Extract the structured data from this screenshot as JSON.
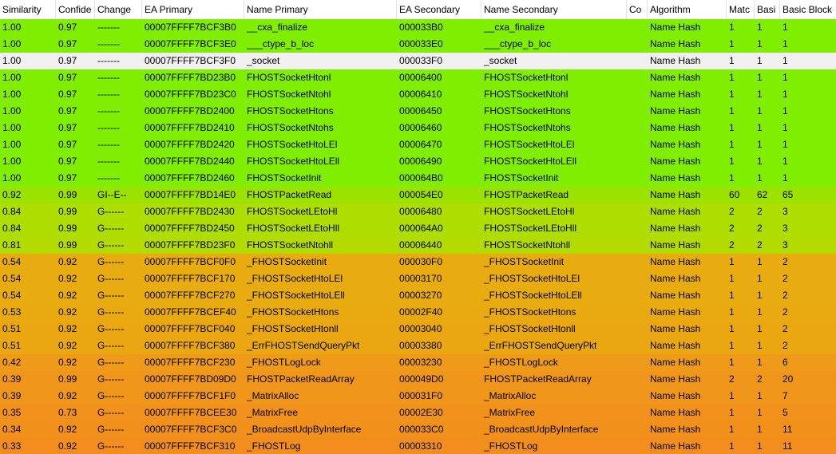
{
  "columns": [
    "Similarity",
    "Confide",
    "Change",
    "EA Primary",
    "Name Primary",
    "EA Secondary",
    "Name Secondary",
    "Co",
    "Algorithm",
    "Matc",
    "Basi",
    "Basic Block"
  ],
  "rows": [
    {
      "similarity": "1.00",
      "confidence": "0.97",
      "change": "-------",
      "ea_primary": "00007FFFF7BCF3B0",
      "name_primary": "__cxa_finalize",
      "ea_secondary": "000033B0",
      "name_secondary": "__cxa_finalize",
      "comment": "",
      "algorithm": "Name Hash",
      "matched": "1",
      "basic": "1",
      "basic_blocks": "1",
      "color": "#80ee00"
    },
    {
      "similarity": "1.00",
      "confidence": "0.97",
      "change": "-------",
      "ea_primary": "00007FFFF7BCF3E0",
      "name_primary": "___ctype_b_loc",
      "ea_secondary": "000033E0",
      "name_secondary": "___ctype_b_loc",
      "comment": "",
      "algorithm": "Name Hash",
      "matched": "1",
      "basic": "1",
      "basic_blocks": "1",
      "color": "#80ee00"
    },
    {
      "similarity": "1.00",
      "confidence": "0.97",
      "change": "-------",
      "ea_primary": "00007FFFF7BCF3F0",
      "name_primary": "_socket",
      "ea_secondary": "000033F0",
      "name_secondary": "_socket",
      "comment": "",
      "algorithm": "Name Hash",
      "matched": "1",
      "basic": "1",
      "basic_blocks": "1",
      "color": "#f0f0f0",
      "selected": true
    },
    {
      "similarity": "1.00",
      "confidence": "0.97",
      "change": "-------",
      "ea_primary": "00007FFFF7BD23B0",
      "name_primary": "FHOSTSocketHtonl",
      "ea_secondary": "00006400",
      "name_secondary": "FHOSTSocketHtonl",
      "comment": "",
      "algorithm": "Name Hash",
      "matched": "1",
      "basic": "1",
      "basic_blocks": "1",
      "color": "#80ee00"
    },
    {
      "similarity": "1.00",
      "confidence": "0.97",
      "change": "-------",
      "ea_primary": "00007FFFF7BD23C0",
      "name_primary": "FHOSTSocketNtohl",
      "ea_secondary": "00006410",
      "name_secondary": "FHOSTSocketNtohl",
      "comment": "",
      "algorithm": "Name Hash",
      "matched": "1",
      "basic": "1",
      "basic_blocks": "1",
      "color": "#80ee00"
    },
    {
      "similarity": "1.00",
      "confidence": "0.97",
      "change": "-------",
      "ea_primary": "00007FFFF7BD2400",
      "name_primary": "FHOSTSocketHtons",
      "ea_secondary": "00006450",
      "name_secondary": "FHOSTSocketHtons",
      "comment": "",
      "algorithm": "Name Hash",
      "matched": "1",
      "basic": "1",
      "basic_blocks": "1",
      "color": "#80ee00"
    },
    {
      "similarity": "1.00",
      "confidence": "0.97",
      "change": "-------",
      "ea_primary": "00007FFFF7BD2410",
      "name_primary": "FHOSTSocketNtohs",
      "ea_secondary": "00006460",
      "name_secondary": "FHOSTSocketNtohs",
      "comment": "",
      "algorithm": "Name Hash",
      "matched": "1",
      "basic": "1",
      "basic_blocks": "1",
      "color": "#80ee00"
    },
    {
      "similarity": "1.00",
      "confidence": "0.97",
      "change": "-------",
      "ea_primary": "00007FFFF7BD2420",
      "name_primary": "FHOSTSocketHtoLEl",
      "ea_secondary": "00006470",
      "name_secondary": "FHOSTSocketHtoLEl",
      "comment": "",
      "algorithm": "Name Hash",
      "matched": "1",
      "basic": "1",
      "basic_blocks": "1",
      "color": "#80ee00"
    },
    {
      "similarity": "1.00",
      "confidence": "0.97",
      "change": "-------",
      "ea_primary": "00007FFFF7BD2440",
      "name_primary": "FHOSTSocketHtoLEll",
      "ea_secondary": "00006490",
      "name_secondary": "FHOSTSocketHtoLEll",
      "comment": "",
      "algorithm": "Name Hash",
      "matched": "1",
      "basic": "1",
      "basic_blocks": "1",
      "color": "#80ee00"
    },
    {
      "similarity": "1.00",
      "confidence": "0.97",
      "change": "-------",
      "ea_primary": "00007FFFF7BD2460",
      "name_primary": "FHOSTSocketInit",
      "ea_secondary": "000064B0",
      "name_secondary": "FHOSTSocketInit",
      "comment": "",
      "algorithm": "Name Hash",
      "matched": "1",
      "basic": "1",
      "basic_blocks": "1",
      "color": "#80ee00"
    },
    {
      "similarity": "0.92",
      "confidence": "0.99",
      "change": "GI--E--",
      "ea_primary": "00007FFFF7BD14E0",
      "name_primary": "FHOSTPacketRead",
      "ea_secondary": "000054E0",
      "name_secondary": "FHOSTPacketRead",
      "comment": "",
      "algorithm": "Name Hash",
      "matched": "60",
      "basic": "62",
      "basic_blocks": "65",
      "color": "#9be200"
    },
    {
      "similarity": "0.84",
      "confidence": "0.99",
      "change": "G------",
      "ea_primary": "00007FFFF7BD2430",
      "name_primary": "FHOSTSocketLEtoHl",
      "ea_secondary": "00006480",
      "name_secondary": "FHOSTSocketLEtoHl",
      "comment": "",
      "algorithm": "Name Hash",
      "matched": "2",
      "basic": "2",
      "basic_blocks": "3",
      "color": "#aedd00"
    },
    {
      "similarity": "0.84",
      "confidence": "0.99",
      "change": "G------",
      "ea_primary": "00007FFFF7BD2450",
      "name_primary": "FHOSTSocketLEtoHll",
      "ea_secondary": "000064A0",
      "name_secondary": "FHOSTSocketLEtoHll",
      "comment": "",
      "algorithm": "Name Hash",
      "matched": "2",
      "basic": "2",
      "basic_blocks": "3",
      "color": "#aedd00"
    },
    {
      "similarity": "0.81",
      "confidence": "0.99",
      "change": "G------",
      "ea_primary": "00007FFFF7BD23F0",
      "name_primary": "FHOSTSocketNtohll",
      "ea_secondary": "00006440",
      "name_secondary": "FHOSTSocketNtohll",
      "comment": "",
      "algorithm": "Name Hash",
      "matched": "2",
      "basic": "2",
      "basic_blocks": "3",
      "color": "#b3db00"
    },
    {
      "similarity": "0.54",
      "confidence": "0.92",
      "change": "G------",
      "ea_primary": "00007FFFF7BCF0F0",
      "name_primary": "_FHOSTSocketInit",
      "ea_secondary": "000030F0",
      "name_secondary": "_FHOSTSocketInit",
      "comment": "",
      "algorithm": "Name Hash",
      "matched": "1",
      "basic": "1",
      "basic_blocks": "2",
      "color": "#e8ac10"
    },
    {
      "similarity": "0.54",
      "confidence": "0.92",
      "change": "G------",
      "ea_primary": "00007FFFF7BCF170",
      "name_primary": "_FHOSTSocketHtoLEl",
      "ea_secondary": "00003170",
      "name_secondary": "_FHOSTSocketHtoLEl",
      "comment": "",
      "algorithm": "Name Hash",
      "matched": "1",
      "basic": "1",
      "basic_blocks": "2",
      "color": "#e8ac10"
    },
    {
      "similarity": "0.54",
      "confidence": "0.92",
      "change": "G------",
      "ea_primary": "00007FFFF7BCF270",
      "name_primary": "_FHOSTSocketHtoLEll",
      "ea_secondary": "00003270",
      "name_secondary": "_FHOSTSocketHtoLEll",
      "comment": "",
      "algorithm": "Name Hash",
      "matched": "1",
      "basic": "1",
      "basic_blocks": "2",
      "color": "#e8ac10"
    },
    {
      "similarity": "0.53",
      "confidence": "0.92",
      "change": "G------",
      "ea_primary": "00007FFFF7BCEF40",
      "name_primary": "_FHOSTSocketHtons",
      "ea_secondary": "00002F40",
      "name_secondary": "_FHOSTSocketHtons",
      "comment": "",
      "algorithm": "Name Hash",
      "matched": "1",
      "basic": "1",
      "basic_blocks": "2",
      "color": "#e9aa10"
    },
    {
      "similarity": "0.51",
      "confidence": "0.92",
      "change": "G------",
      "ea_primary": "00007FFFF7BCF040",
      "name_primary": "_FHOSTSocketHtonll",
      "ea_secondary": "00003040",
      "name_secondary": "_FHOSTSocketHtonll",
      "comment": "",
      "algorithm": "Name Hash",
      "matched": "1",
      "basic": "1",
      "basic_blocks": "2",
      "color": "#eaa712"
    },
    {
      "similarity": "0.51",
      "confidence": "0.92",
      "change": "G------",
      "ea_primary": "00007FFFF7BCF380",
      "name_primary": "_ErrFHOSTSendQueryPkt",
      "ea_secondary": "00003380",
      "name_secondary": "_ErrFHOSTSendQueryPkt",
      "comment": "",
      "algorithm": "Name Hash",
      "matched": "1",
      "basic": "1",
      "basic_blocks": "2",
      "color": "#eaa712"
    },
    {
      "similarity": "0.42",
      "confidence": "0.92",
      "change": "G------",
      "ea_primary": "00007FFFF7BCF230",
      "name_primary": "_FHOSTLogLock",
      "ea_secondary": "00003230",
      "name_secondary": "_FHOSTLogLock",
      "comment": "",
      "algorithm": "Name Hash",
      "matched": "1",
      "basic": "1",
      "basic_blocks": "6",
      "color": "#ef9a18"
    },
    {
      "similarity": "0.39",
      "confidence": "0.99",
      "change": "G------",
      "ea_primary": "00007FFFF7BD09D0",
      "name_primary": "FHOSTPacketReadArray",
      "ea_secondary": "000049D0",
      "name_secondary": "FHOSTPacketReadArray",
      "comment": "",
      "algorithm": "Name Hash",
      "matched": "2",
      "basic": "2",
      "basic_blocks": "20",
      "color": "#f0961a"
    },
    {
      "similarity": "0.39",
      "confidence": "0.92",
      "change": "G------",
      "ea_primary": "00007FFFF7BCF1F0",
      "name_primary": "_MatrixAlloc",
      "ea_secondary": "000031F0",
      "name_secondary": "_MatrixAlloc",
      "comment": "",
      "algorithm": "Name Hash",
      "matched": "1",
      "basic": "1",
      "basic_blocks": "7",
      "color": "#f0961a"
    },
    {
      "similarity": "0.35",
      "confidence": "0.73",
      "change": "G------",
      "ea_primary": "00007FFFF7BCEE30",
      "name_primary": "_MatrixFree",
      "ea_secondary": "00002E30",
      "name_secondary": "_MatrixFree",
      "comment": "",
      "algorithm": "Name Hash",
      "matched": "1",
      "basic": "1",
      "basic_blocks": "5",
      "color": "#f2921c"
    },
    {
      "similarity": "0.34",
      "confidence": "0.92",
      "change": "G------",
      "ea_primary": "00007FFFF7BCF3C0",
      "name_primary": "_BroadcastUdpByInterface",
      "ea_secondary": "000033C0",
      "name_secondary": "_BroadcastUdpByInterface",
      "comment": "",
      "algorithm": "Name Hash",
      "matched": "1",
      "basic": "1",
      "basic_blocks": "11",
      "color": "#f2901c"
    },
    {
      "similarity": "0.33",
      "confidence": "0.92",
      "change": "G------",
      "ea_primary": "00007FFFF7BCF310",
      "name_primary": "_FHOSTLog",
      "ea_secondary": "00003310",
      "name_secondary": "_FHOSTLog",
      "comment": "",
      "algorithm": "Name Hash",
      "matched": "1",
      "basic": "1",
      "basic_blocks": "11",
      "color": "#f38e1e"
    }
  ]
}
